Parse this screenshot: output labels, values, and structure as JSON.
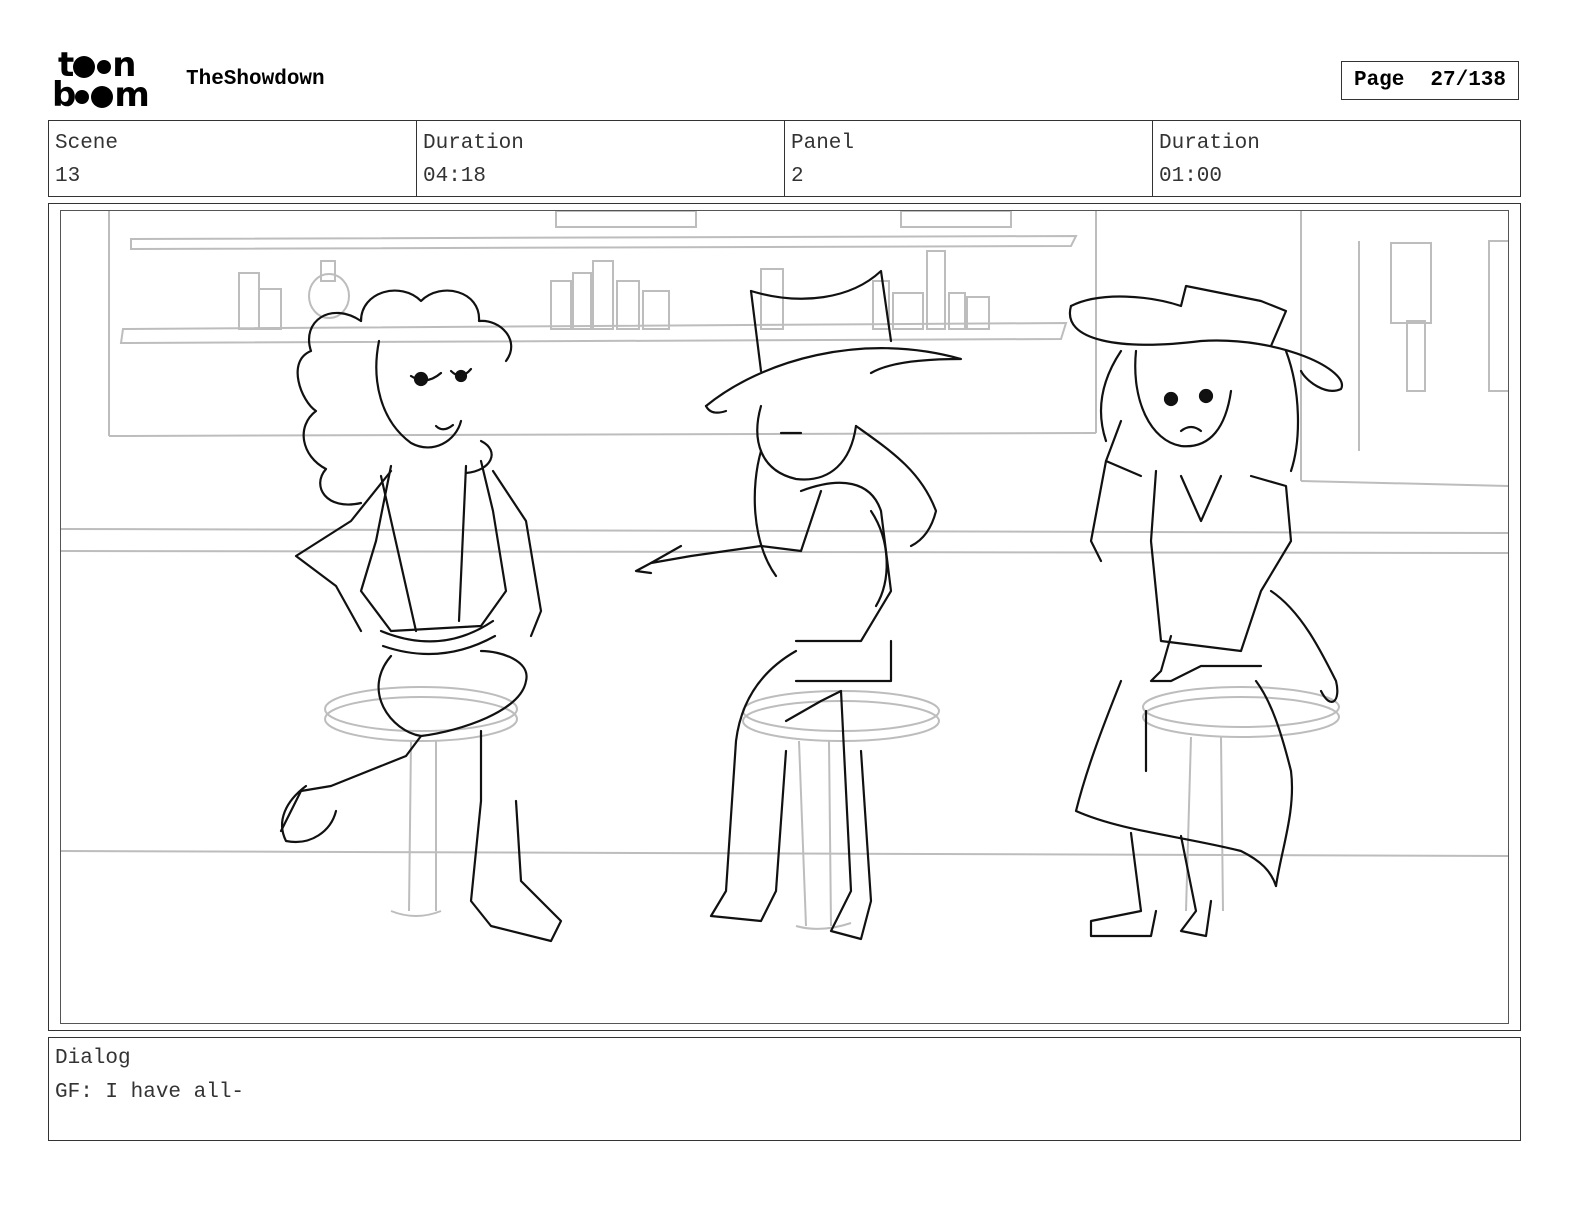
{
  "header": {
    "logo_text_top": "toon",
    "logo_text_bottom": "boom",
    "project_title": "TheShowdown",
    "page_label": "Page",
    "page_value": "27/138"
  },
  "info": {
    "scene_label": "Scene",
    "scene_value": "13",
    "scene_duration_label": "Duration",
    "scene_duration_value": "04:18",
    "panel_label": "Panel",
    "panel_value": "2",
    "panel_duration_label": "Duration",
    "panel_duration_value": "01:00"
  },
  "dialog": {
    "label": "Dialog",
    "text": "GF: I have all-"
  }
}
